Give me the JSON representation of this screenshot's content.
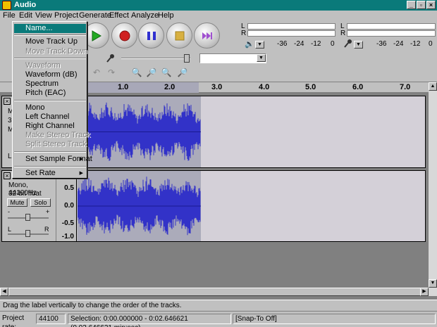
{
  "window": {
    "title": "Audio",
    "min": "_",
    "max": "▫",
    "close": "×"
  },
  "menubar": [
    "File",
    "Edit",
    "View",
    "Project",
    "Generate",
    "Effect",
    "Analyze",
    "Help"
  ],
  "meters": {
    "left_L": "L",
    "left_R": "R",
    "right_L": "L",
    "right_R": "R",
    "scale_left": [
      "-36",
      "-24",
      "-12",
      "0"
    ],
    "scale_right": [
      "-36",
      "-24",
      "-12",
      "0"
    ]
  },
  "ruler": {
    "ticks": [
      "1.0",
      "2.0",
      "3.0",
      "4.0",
      "5.0",
      "6.0",
      "7.0"
    ]
  },
  "context_menu": {
    "items": [
      {
        "label": "Name...",
        "state": "highlighted"
      },
      {
        "label": "Move Track Up",
        "state": "enabled"
      },
      {
        "label": "Move Track Down",
        "state": "disabled"
      },
      {
        "label": "Waveform",
        "state": "disabled"
      },
      {
        "label": "Waveform (dB)",
        "state": "enabled"
      },
      {
        "label": "Spectrum",
        "state": "enabled"
      },
      {
        "label": "Pitch (EAC)",
        "state": "enabled"
      },
      {
        "label": "Mono",
        "state": "enabled"
      },
      {
        "label": "Left Channel",
        "state": "enabled"
      },
      {
        "label": "Right Channel",
        "state": "enabled"
      },
      {
        "label": "Make Stereo Track",
        "state": "disabled"
      },
      {
        "label": "Split Stereo Track",
        "state": "disabled"
      },
      {
        "label": "Set Sample Format",
        "state": "enabled",
        "submenu": true
      },
      {
        "label": "Set Rate",
        "state": "enabled",
        "submenu": true
      }
    ]
  },
  "track1": {
    "close": "×",
    "partial_labels": [
      "M",
      "3",
      "M",
      "L"
    ]
  },
  "track2": {
    "close": "×",
    "info": "Mono, 44100Hz",
    "format": "32-bit float",
    "mute": "Mute",
    "solo": "Solo",
    "gain_minus": "-",
    "gain_plus": "+",
    "pan_left": "L",
    "pan_right": "R",
    "vruler": [
      "0.5",
      "0.0",
      "-0.5",
      "-1.0"
    ]
  },
  "status": "Drag the label vertically to change the order of the tracks.",
  "bottom": {
    "rate_label": "Project rate:",
    "rate_value": "44100",
    "selection": "Selection: 0:00.000000 - 0:02.646621 (0.02.646621 min:sec)",
    "snap": "[Snap-To Off]"
  },
  "colors": {
    "titlebar": "#0a7a7a",
    "waveform": "#3232c8",
    "selection": "#ababba"
  }
}
